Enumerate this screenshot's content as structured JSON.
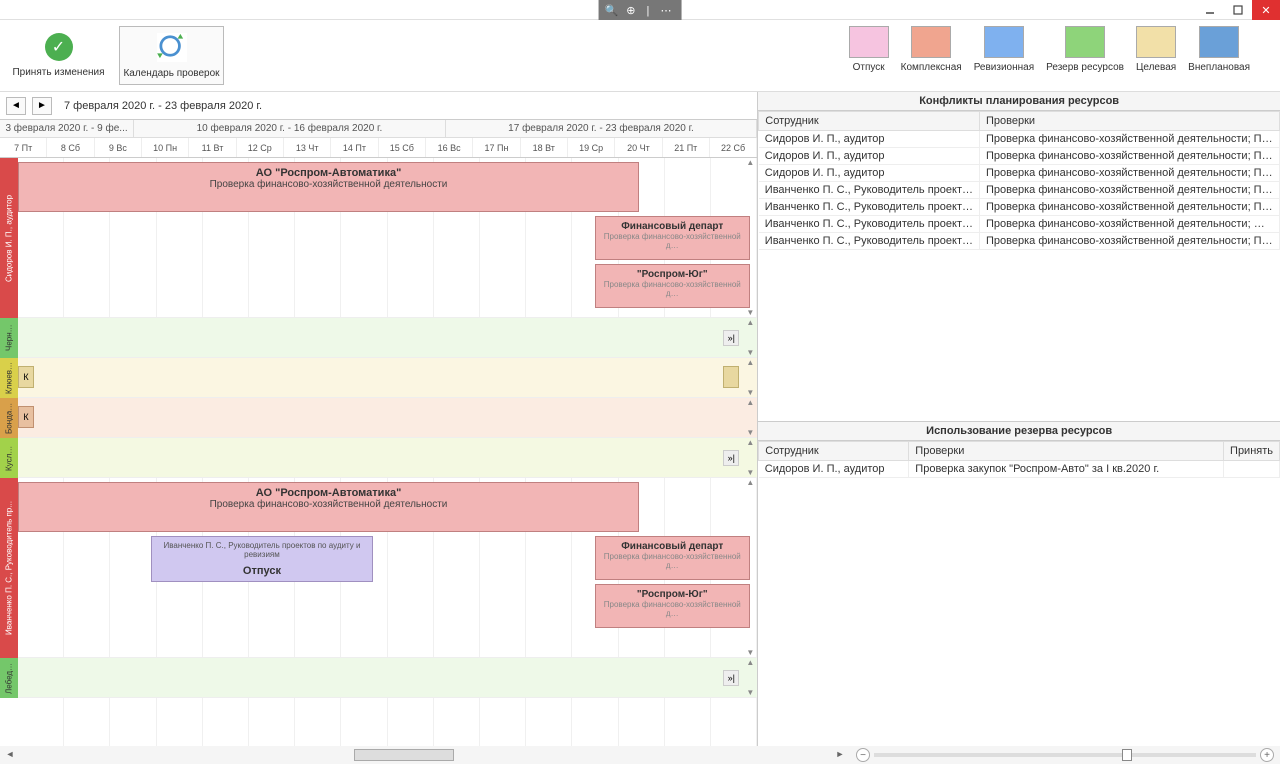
{
  "window": {
    "title_glyphs": "⊕ | ⋯"
  },
  "toolbar": {
    "accept_label": "Принять изменения",
    "calendar_label": "Календарь проверок",
    "legend": [
      {
        "label": "Отпуск",
        "color": "#f6c4e0"
      },
      {
        "label": "Комплексная",
        "color": "#f0a58f"
      },
      {
        "label": "Ревизионная",
        "color": "#7fb1ef"
      },
      {
        "label": "Резерв ресурсов",
        "color": "#8ed47a"
      },
      {
        "label": "Целевая",
        "color": "#f2e0a8"
      },
      {
        "label": "Внеплановая",
        "color": "#6aa0d8"
      }
    ]
  },
  "gantt": {
    "range": "7 февраля 2020 г. - 23 февраля 2020 г.",
    "weeks": [
      "3 февраля 2020 г. - 9 фе...",
      "10 февраля 2020 г. - 16 февраля 2020 г.",
      "17 февраля 2020 г. - 23 февраля 2020 г."
    ],
    "days": [
      "7 Пт",
      "8 Сб",
      "9 Вс",
      "10 Пн",
      "11 Вт",
      "12 Ср",
      "13 Чт",
      "14 Пт",
      "15 Сб",
      "16 Вс",
      "17 Пн",
      "18 Вт",
      "19 Ср",
      "20 Чт",
      "21 Пт",
      "22 Сб"
    ],
    "rows": {
      "r0_label": "Сидоров И. П., аудитор",
      "r5_label": "Иванченко П. С., Руководитель пр...",
      "other1": "Черн…",
      "other2": "Клюев…",
      "other3": "Бонда…",
      "other4": "Кусл…",
      "other5": "Лебед…"
    },
    "bars": {
      "b1_title": "АО \"Роспром-Автоматика\"",
      "b1_sub": "Проверка финансово-хозяйственной деятельности",
      "b2_title": "Финансовый департ",
      "b2_sub": "Проверка финансово-хозяйственной д…",
      "b3_title": "\"Роспром-Юг\"",
      "b3_sub": "Проверка финансово-хозяйственной д…",
      "vac_person": "Иванченко П. С., Руководитель проектов по аудиту и ревизиям",
      "vac_label": "Отпуск"
    }
  },
  "conflicts": {
    "title": "Конфликты планирования ресурсов",
    "cols": {
      "emp": "Сотрудник",
      "checks": "Проверки"
    },
    "rows": [
      [
        "Сидоров И. П., аудитор",
        "Проверка финансово-хозяйственной деятельности; Проверка фи…"
      ],
      [
        "Сидоров И. П., аудитор",
        "Проверка финансово-хозяйственной деятельности; Проверка фи…"
      ],
      [
        "Сидоров И. П., аудитор",
        "Проверка финансово-хозяйственной деятельности; Проверка фи…"
      ],
      [
        "Иванченко П. С., Руководитель проект…",
        "Проверка финансово-хозяйственной деятельности; Проверка фи…"
      ],
      [
        "Иванченко П. С., Руководитель проект…",
        "Проверка финансово-хозяйственной деятельности; Проверка фи…"
      ],
      [
        "Иванченко П. С., Руководитель проект…",
        "Проверка финансово-хозяйственной деятельности; Отпуск"
      ],
      [
        "Иванченко П. С., Руководитель проект…",
        "Проверка финансово-хозяйственной деятельности; Проверка фи…"
      ]
    ]
  },
  "reserve": {
    "title": "Использование резерва ресурсов",
    "cols": {
      "emp": "Сотрудник",
      "checks": "Проверки",
      "accept": "Принять"
    },
    "rows": [
      [
        "Сидоров И. П., аудитор",
        "Проверка закупок \"Роспром-Авто\" за I кв.2020 г.",
        ""
      ]
    ]
  }
}
